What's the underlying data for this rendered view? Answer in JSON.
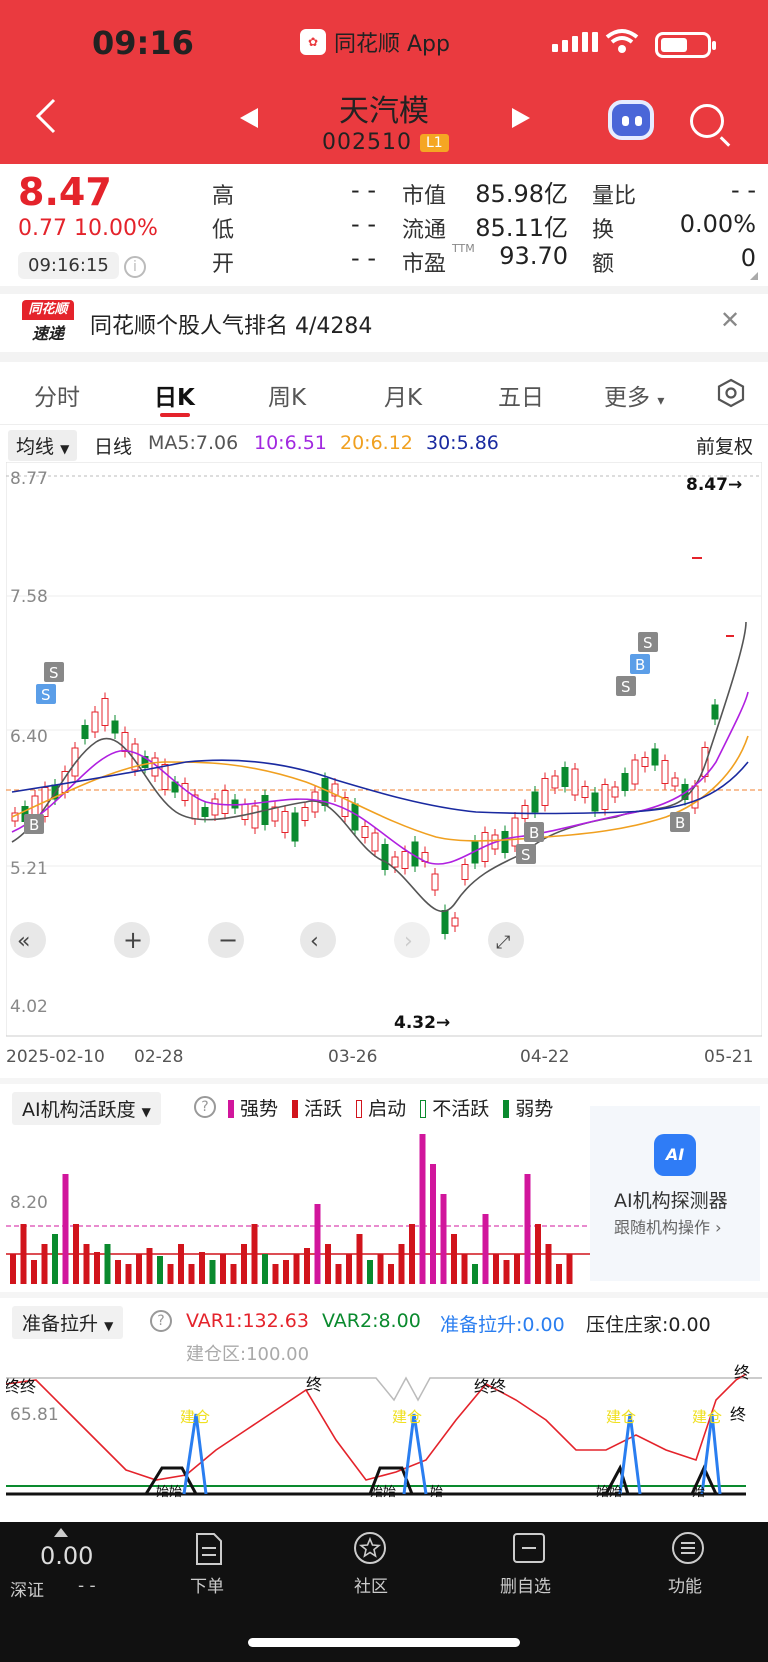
{
  "status": {
    "time": "09:16",
    "app_name": "同花顺 App"
  },
  "header": {
    "stock_name": "天汽模",
    "stock_code": "002510",
    "badge": "L1"
  },
  "quote": {
    "price": "8.47",
    "change": "0.77  10.00%",
    "time": "09:16:15",
    "fields": [
      {
        "label": "高",
        "value": "- -"
      },
      {
        "label": "低",
        "value": "- -"
      },
      {
        "label": "开",
        "value": "- -"
      },
      {
        "label": "市值",
        "value": "85.98亿"
      },
      {
        "label": "流通",
        "value": "85.11亿"
      },
      {
        "label": "市盈",
        "sup": "TTM",
        "value": "93.70"
      },
      {
        "label": "量比",
        "value": "- -"
      },
      {
        "label": "换",
        "value": "0.00%"
      },
      {
        "label": "额",
        "value": "0"
      }
    ]
  },
  "news": {
    "logo_top": "同花顺",
    "logo_bottom": "速递",
    "text": "同花顺个股人气排名 4/4284"
  },
  "tabs": [
    "分时",
    "日K",
    "周K",
    "月K",
    "五日",
    "更多"
  ],
  "ma": {
    "selector": "均线",
    "period": "日线",
    "ma5": "MA5:7.06",
    "ma10": "10:6.51",
    "ma20": "20:6.12",
    "ma30": "30:5.86",
    "adjust": "前复权"
  },
  "kline": {
    "y_labels": [
      "8.77",
      "7.58",
      "6.40",
      "5.21",
      "4.02"
    ],
    "high_marker": "8.47→",
    "low_marker": "4.32→",
    "dates": [
      "2025-02-10",
      "02-28",
      "03-26",
      "04-22",
      "05-21"
    ],
    "signals": [
      "S",
      "S",
      "B",
      "B",
      "S",
      "S",
      "B",
      "S",
      "B"
    ]
  },
  "ai_indicator": {
    "selector": "AI机构活跃度",
    "legend": [
      "强势",
      "活跃",
      "启动",
      "不活跃",
      "弱势"
    ],
    "y_label": "8.20",
    "card_title": "AI机构探测器",
    "card_sub": "跟随机构操作 ›"
  },
  "prep_indicator": {
    "selector": "准备拉升",
    "var1": "VAR1:132.63",
    "var2": "VAR2:8.00",
    "prep": "准备拉升:0.00",
    "press": "压住庄家:0.00",
    "build": "建仓区:100.00",
    "y_label": "65.81",
    "marks": [
      "终终",
      "终",
      "终终",
      "终",
      "终"
    ],
    "jc": [
      "建仓",
      "建仓",
      "建仓",
      "建仓"
    ],
    "start": [
      "始始",
      "始始",
      "始",
      "始始",
      "始"
    ]
  },
  "bottom_nav": {
    "index_value": "0.00",
    "index_name": "深证",
    "index_change": "- -",
    "items": [
      "下单",
      "社区",
      "删自选",
      "功能"
    ]
  },
  "colors": {
    "brand": "#ea3a3f",
    "up": "#e4232b",
    "down": "#0a8a2e"
  }
}
